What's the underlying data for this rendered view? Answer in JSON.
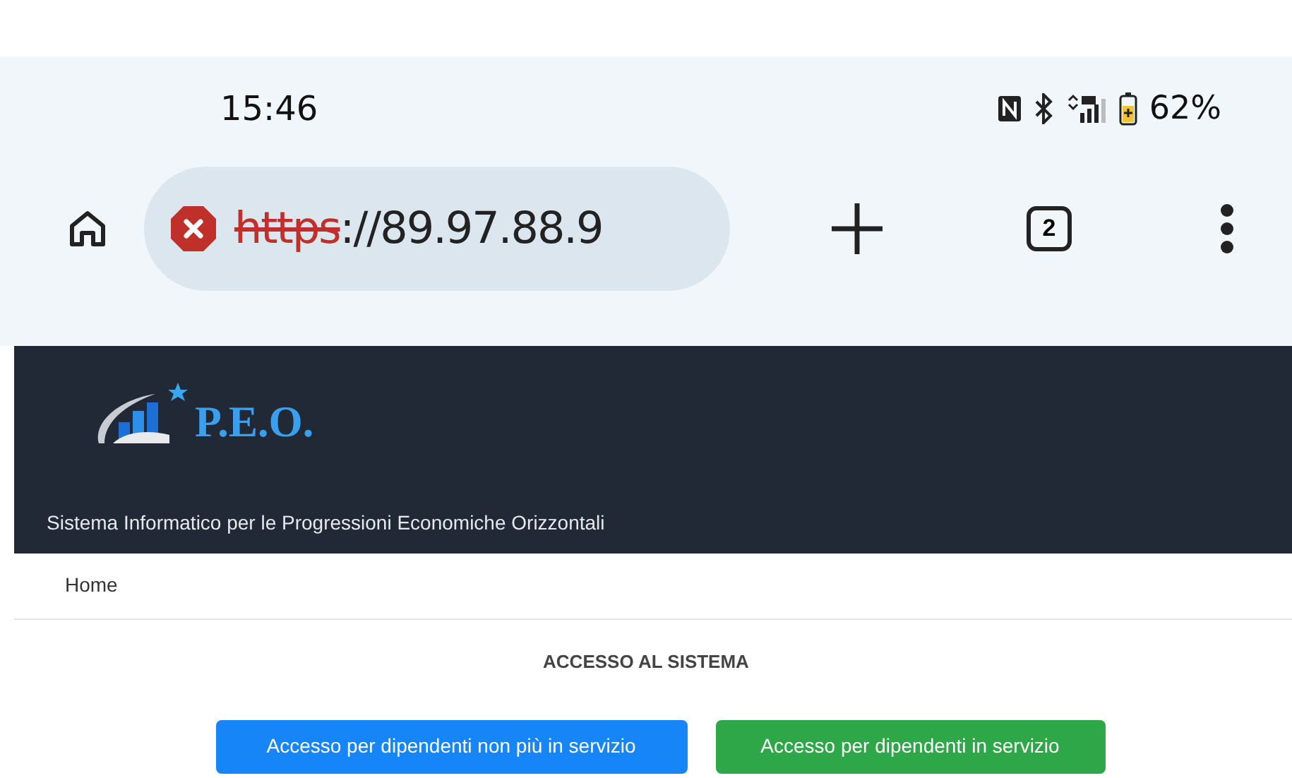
{
  "status_bar": {
    "time": "15:46",
    "battery": "62%"
  },
  "browser": {
    "url_scheme": "https",
    "url_rest": "://89.97.88.9",
    "tab_count": "2",
    "insecure": true
  },
  "header": {
    "logo_text": "P.E.O.",
    "subtitle": "Sistema Informatico per le Progressioni Economiche Orizzontali"
  },
  "breadcrumb": [
    "Home"
  ],
  "title": "ACCESSO AL SISTEMA",
  "buttons": [
    {
      "label": "Accesso per dipendenti non più in servizio",
      "kind": "primary"
    },
    {
      "label": "Accesso per dipendenti in servizio",
      "kind": "success"
    }
  ]
}
